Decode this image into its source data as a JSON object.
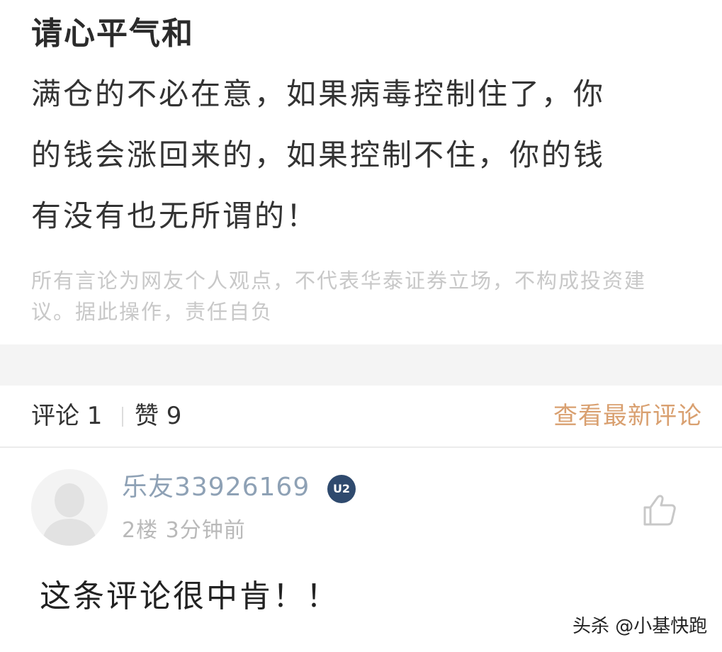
{
  "post": {
    "title": "请心平气和",
    "body_lines": [
      "满仓的不必在意，如果病毒控制住了，你",
      "的钱会涨回来的，如果控制不住，你的钱",
      "有没有也无所谓的！"
    ],
    "disclaimer_lines": [
      "所有言论为网友个人观点，不代表华泰证券立场，不构成投资建",
      "议。据此操作，责任自负"
    ]
  },
  "stats_bar": {
    "comments_label": "评论 1",
    "likes_label": "赞 9",
    "latest_link": "查看最新评论"
  },
  "comment": {
    "username": "乐友33926169",
    "level_badge": "U2",
    "meta": "2楼  3分钟前",
    "text": "这条评论很中肯！！"
  },
  "watermark": "头杀 @小基快跑",
  "icons": {
    "avatar": "default-user-avatar-icon",
    "like": "thumbs-up-icon",
    "badge": "level-badge-icon"
  },
  "colors": {
    "latest_link": "#d9a070",
    "username": "#8ea1b5",
    "disclaimer": "#c8c8c8",
    "badge": "#2f4a6e"
  }
}
